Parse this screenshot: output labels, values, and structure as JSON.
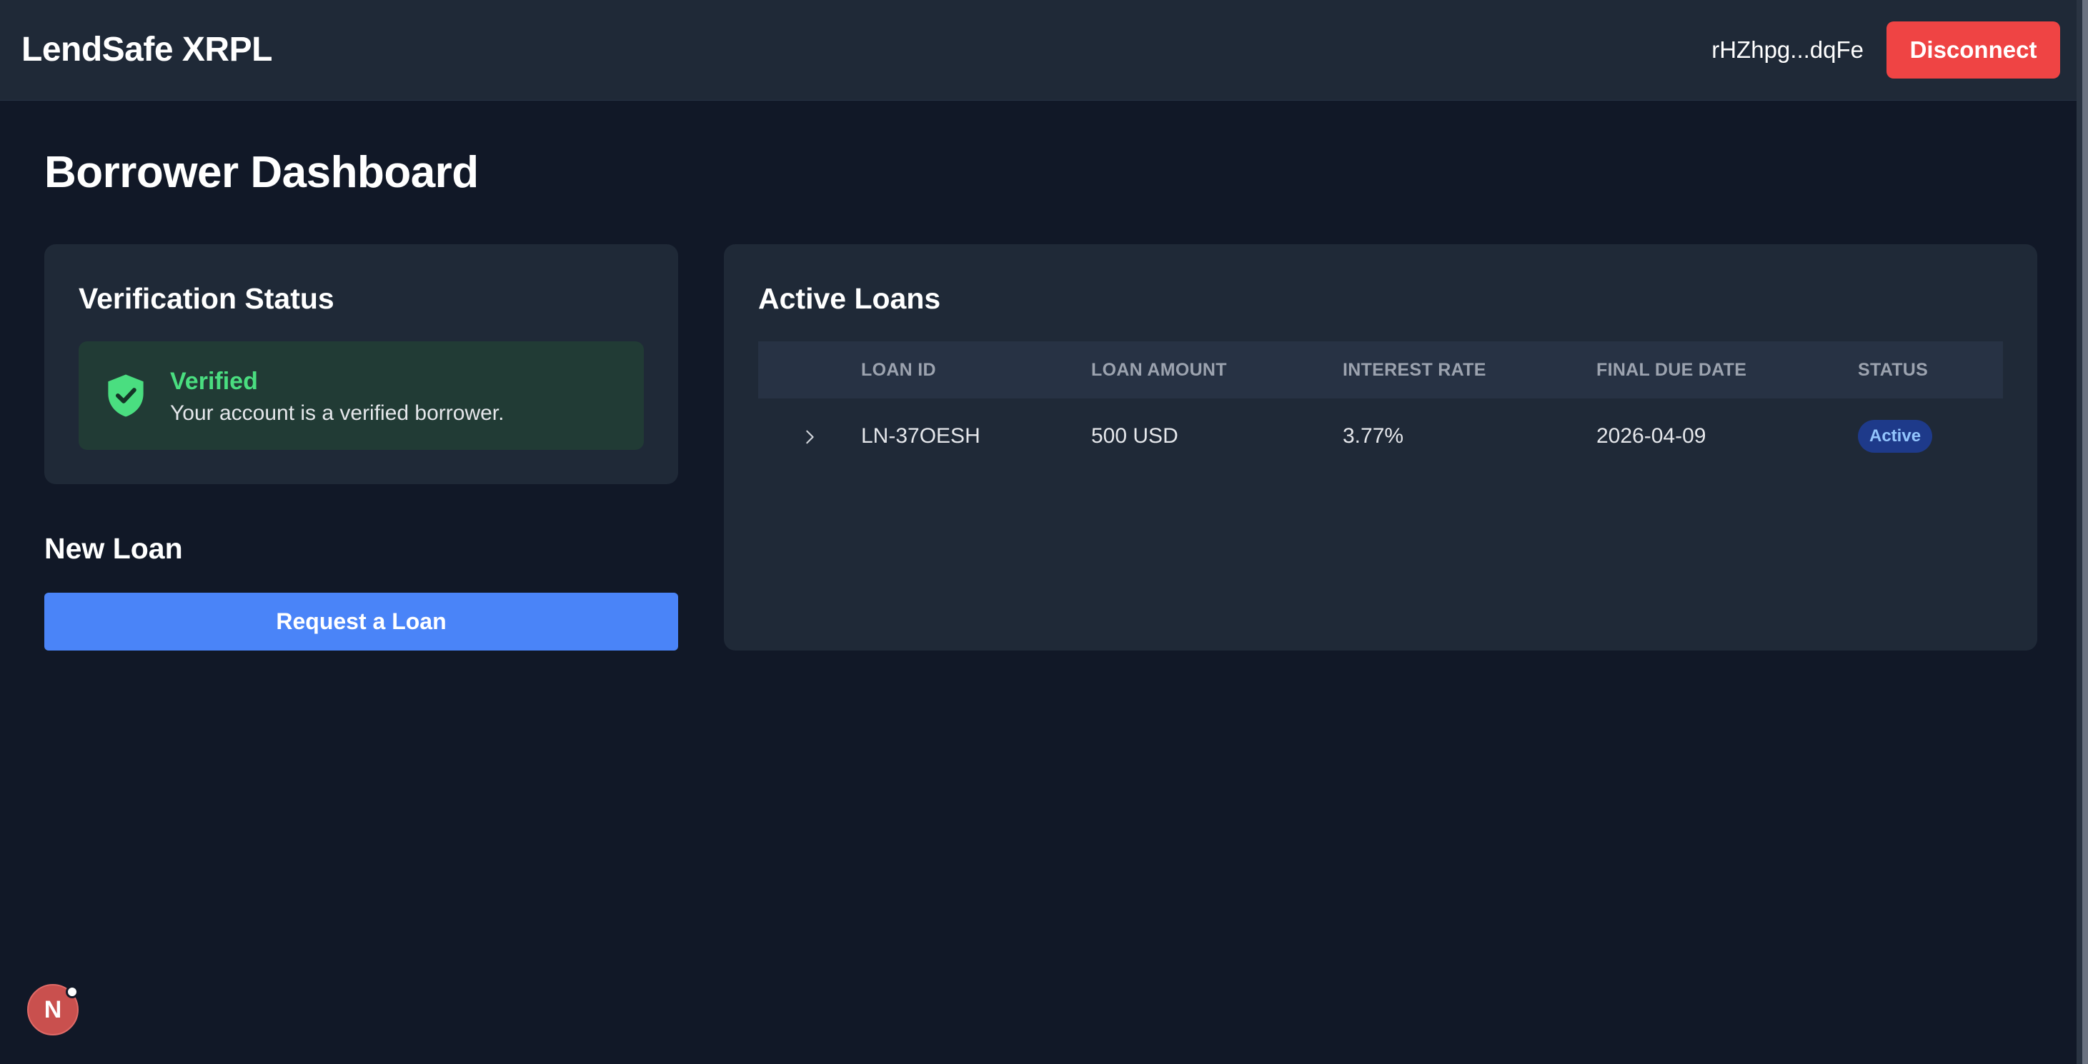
{
  "header": {
    "brand": "LendSafe XRPL",
    "wallet_address": "rHZhpg...dqFe",
    "disconnect_label": "Disconnect"
  },
  "page": {
    "title": "Borrower Dashboard"
  },
  "verification": {
    "title": "Verification Status",
    "status_label": "Verified",
    "status_description": "Your account is a verified borrower.",
    "icon": "shield-check-icon",
    "status_color": "#4ade80"
  },
  "new_loan": {
    "title": "New Loan",
    "request_label": "Request a Loan"
  },
  "active_loans": {
    "title": "Active Loans",
    "columns": [
      "",
      "LOAN ID",
      "LOAN AMOUNT",
      "INTEREST RATE",
      "FINAL DUE DATE",
      "STATUS"
    ],
    "rows": [
      {
        "loan_id": "LN-37OESH",
        "loan_amount": "500 USD",
        "interest_rate": "3.77%",
        "final_due_date": "2026-04-09",
        "status": "Active"
      }
    ]
  },
  "dev_badge": {
    "letter": "N"
  },
  "colors": {
    "background": "#111827",
    "surface": "#1f2937",
    "danger": "#ef4444",
    "primary": "#4a84f8",
    "success": "#4ade80"
  }
}
